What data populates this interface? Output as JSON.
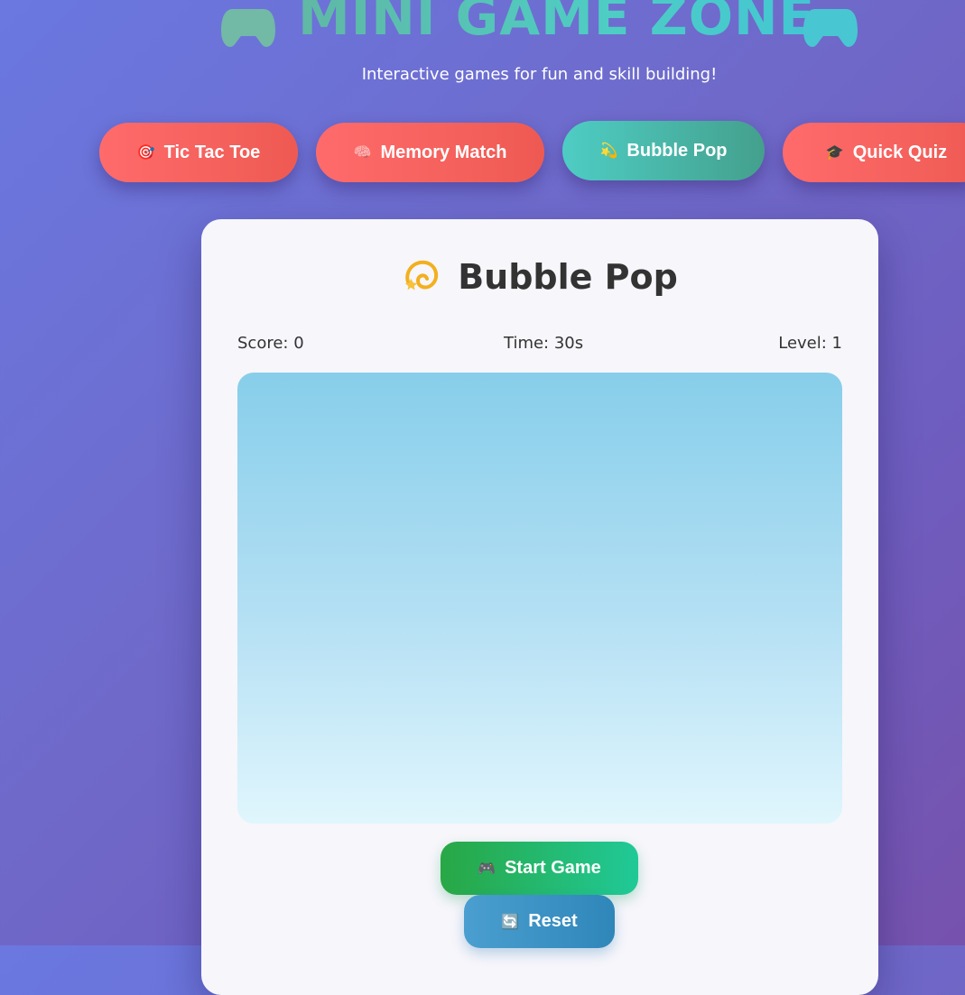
{
  "header": {
    "title": "MINI GAME ZONE",
    "subtitle": "Interactive games for fun and skill building!",
    "title_icon": "gamepad-icon"
  },
  "nav": {
    "items": [
      {
        "label": "Tic Tac Toe",
        "icon": "🎯",
        "active": false
      },
      {
        "label": "Memory Match",
        "icon": "🧠",
        "active": false
      },
      {
        "label": "Bubble Pop",
        "icon": "💫",
        "active": true
      },
      {
        "label": "Quick Quiz",
        "icon": "🎓",
        "active": false
      }
    ]
  },
  "game": {
    "title": "Bubble Pop",
    "title_icon": "💫",
    "score": "Score: 0",
    "time": "Time: 30s",
    "level": "Level: 1",
    "start_label": "Start Game",
    "start_icon": "🎮",
    "reset_label": "Reset",
    "reset_icon": "🔄"
  },
  "colors": {
    "accent_teal": "#4ecdc4",
    "nav_red": "#ff6b6b",
    "start_green": "#28a745",
    "reset_blue": "#2f86b8"
  }
}
